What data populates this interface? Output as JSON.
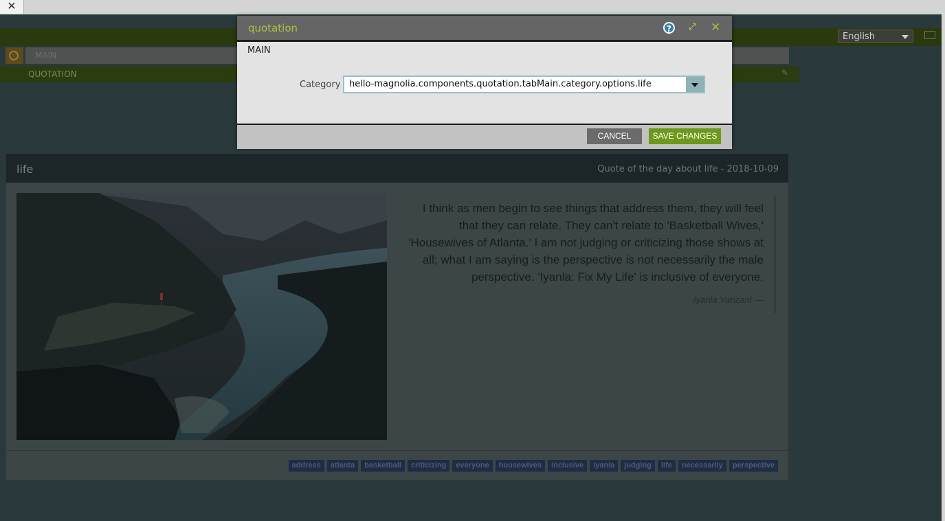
{
  "browser": {
    "close_glyph": "✕"
  },
  "editor": {
    "language": {
      "selected": "English"
    },
    "areas": [
      {
        "label": "MAIN"
      },
      {
        "label": "QUOTATION"
      }
    ]
  },
  "card": {
    "title": "life",
    "subtitle": "Quote of the day about life - 2018-10-09",
    "quote": "I think as men begin to see things that address them, they will feel that they can relate. They can't relate to 'Basketball Wives,' 'Housewives of Atlanta.' I am not judging or criticizing those shows at all; what I am saying is the perspective is not necessarily the male perspective. 'Iyanla: Fix My Life' is inclusive of everyone.",
    "author": "Iyanla Vanzant —",
    "tags": [
      "address",
      "atlanta",
      "basketball",
      "criticizing",
      "everyone",
      "housewives",
      "inclusive",
      "iyanla",
      "judging",
      "life",
      "necessarily",
      "perspective"
    ]
  },
  "dialog": {
    "title": "quotation",
    "help_glyph": "?",
    "tab": "MAIN",
    "field": {
      "label": "Category",
      "value": "hello-magnolia.components.quotation.tabMain.category.options.life"
    },
    "cancel_label": "CANCEL",
    "save_label": "SAVE CHANGES"
  },
  "colors": {
    "accent": "#a9c23b",
    "save": "#6a9a17",
    "cancel": "#6b6b6b",
    "tag_bg": "#1e2c45"
  }
}
